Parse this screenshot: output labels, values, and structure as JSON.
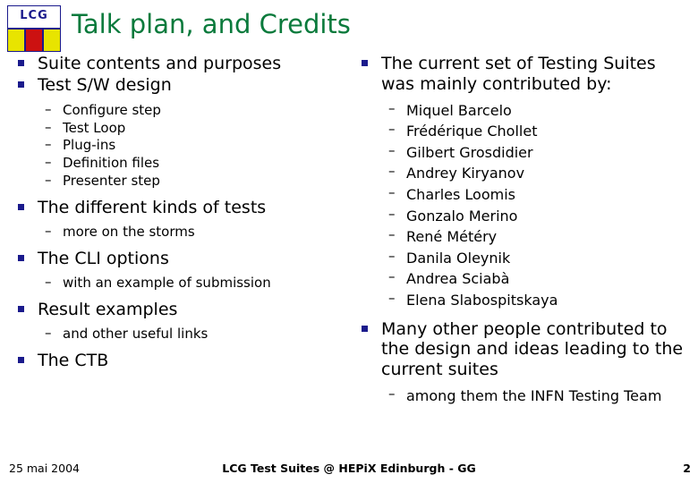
{
  "slide": {
    "title": "Talk plan, and Credits",
    "logo": {
      "text": "LCG"
    },
    "left_column": [
      {
        "level": 1,
        "text": "Suite contents and purposes"
      },
      {
        "level": 1,
        "text": "Test S/W design"
      },
      {
        "level": 2,
        "marker": "–",
        "text": "Configure step"
      },
      {
        "level": 2,
        "marker": "–",
        "text": "Test Loop"
      },
      {
        "level": 2,
        "marker": "–",
        "text": "Plug-ins"
      },
      {
        "level": 2,
        "marker": "–",
        "text": "Definition files"
      },
      {
        "level": 2,
        "marker": "–",
        "text": "Presenter step"
      },
      {
        "level": 1,
        "text": "The different kinds of tests"
      },
      {
        "level": 2,
        "marker": "–",
        "text": "more on the storms"
      },
      {
        "level": 1,
        "text": "The CLI options"
      },
      {
        "level": 2,
        "marker": "–",
        "text": "with an example of submission"
      },
      {
        "level": 1,
        "text": "Result examples"
      },
      {
        "level": 2,
        "marker": "–",
        "text": "and other useful links"
      },
      {
        "level": 1,
        "text": "The CTB"
      }
    ],
    "right_column": [
      {
        "level": 1,
        "text": "The current set of Testing Suites was mainly contributed by:"
      },
      {
        "level": 2,
        "marker": "–",
        "text": "Miquel Barcelo"
      },
      {
        "level": 2,
        "marker": "–",
        "text": "Frédérique Chollet"
      },
      {
        "level": 2,
        "marker": "–",
        "text": "Gilbert Grosdidier"
      },
      {
        "level": 2,
        "marker": "–",
        "text": "Andrey Kiryanov"
      },
      {
        "level": 2,
        "marker": "–",
        "text": "Charles Loomis"
      },
      {
        "level": 2,
        "marker": "–",
        "text": "Gonzalo Merino"
      },
      {
        "level": 2,
        "marker": "–",
        "text": "René Météry"
      },
      {
        "level": 2,
        "marker": "–",
        "text": "Danila Oleynik"
      },
      {
        "level": 2,
        "marker": "–",
        "text": "Andrea Sciabà"
      },
      {
        "level": 2,
        "marker": "–",
        "text": "Elena Slabospitskaya"
      },
      {
        "level": 1,
        "text": "Many other people contributed to the design and ideas leading to the current suites"
      },
      {
        "level": 2,
        "marker": "–",
        "text": "among them the INFN Testing Team"
      }
    ],
    "footer": {
      "date": "25 mai 2004",
      "center": "LCG Test Suites @ HEPiX Edinburgh - GG",
      "page": "2"
    },
    "colors": {
      "title": "#0a7a3c",
      "bullet_marker": "#1a1a8c",
      "logo_yellow": "#e8e400",
      "logo_red": "#cc1111",
      "logo_border": "#1a1a8c"
    }
  }
}
